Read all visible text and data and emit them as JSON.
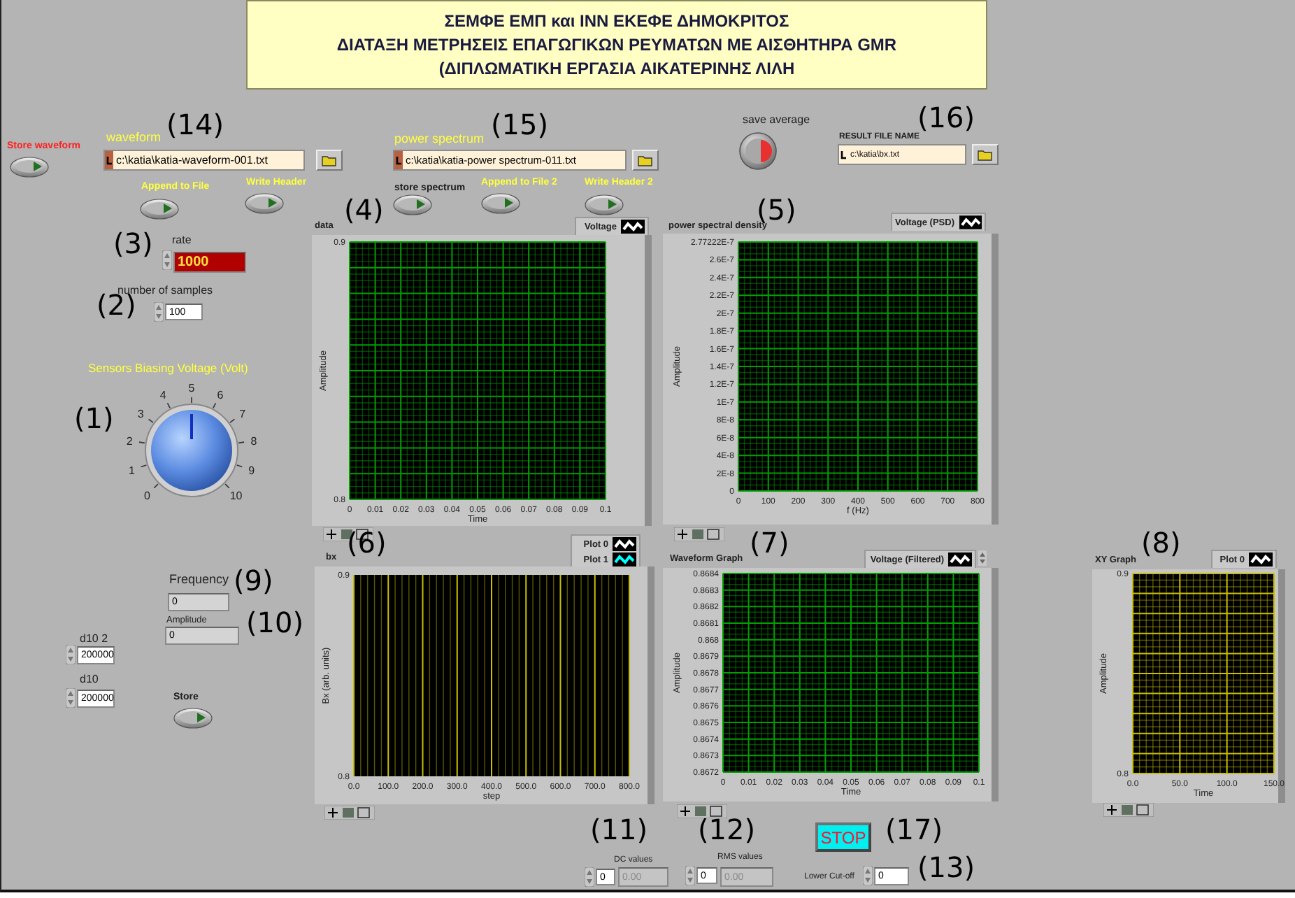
{
  "header": {
    "lines": [
      "ΣΕΜΦΕ ΕΜΠ και ΙΝΝ ΕΚΕΦΕ ΔΗΜΟΚΡΙΤΟΣ",
      "ΔΙΑΤΑΞΗ ΜΕΤΡΗΣΕΙΣ ΕΠΑΓΩΓΙΚΩΝ ΡΕΥΜΑΤΩΝ ΜΕ ΑΙΣΘΗΤΗΡΑ GMR",
      "(ΔΙΠΛΩΜΑΤΙΚΗ ΕΡΓΑΣΙΑ ΑΙΚΑΤΕΡΙΝΗΣ ΛΙΛΗ"
    ]
  },
  "path_controls": [
    {
      "label": "waveform",
      "color": "#ffff40",
      "value": "c:\\katia\\katia-waveform-001.txt",
      "callout": "(14)"
    },
    {
      "label": "power spectrum",
      "color": "#ffff40",
      "value": "c:\\katia\\katia-power spectrum-011.txt",
      "callout": "(15)"
    },
    {
      "label": "RESULT FILE NAME",
      "color": "#202020",
      "value": "c:\\katia\\bx.txt",
      "callout": "(16)"
    }
  ],
  "toggles": [
    {
      "label": "Store waveform",
      "color": "#ff2020",
      "on": false
    },
    {
      "label": "Append to File",
      "color": "#ffff40",
      "on": false
    },
    {
      "label": "Write Header",
      "color": "#ffff40",
      "on": false
    },
    {
      "label": "store spectrum",
      "color": "#202020",
      "on": false
    },
    {
      "label": "Append to File 2",
      "color": "#ffff40",
      "on": false
    },
    {
      "label": "Write Header 2",
      "color": "#ffff40",
      "on": false
    },
    {
      "label": "Store",
      "color": "#202020",
      "on": false
    }
  ],
  "save_average": {
    "label": "save average"
  },
  "numerics": [
    {
      "kind": "control",
      "label": "rate",
      "value": "1000",
      "color": "#b00000",
      "disabled": false,
      "callout": "(3)"
    },
    {
      "kind": "control",
      "label": "number of samples",
      "value": "100",
      "color": "#ffffff",
      "disabled": false,
      "callout": "(2)"
    },
    {
      "kind": "control",
      "label": "d10 2",
      "value": "200000",
      "color": "#ffffff",
      "disabled": false
    },
    {
      "kind": "control",
      "label": "d10",
      "value": "200000",
      "color": "#ffffff",
      "disabled": false
    },
    {
      "kind": "indicator",
      "label": "Frequency",
      "value": "0",
      "color": "#d4d4d4",
      "disabled": false,
      "callout": "(9)"
    },
    {
      "kind": "indicator",
      "label": "Amplitude",
      "value": "0",
      "color": "#d4d4d4",
      "disabled": false,
      "callout": "(10)"
    },
    {
      "kind": "control",
      "value": "0",
      "color": "#ffffff",
      "disabled": false,
      "callout": "(11)"
    },
    {
      "kind": "indicator",
      "label": "DC values",
      "value": "0.00",
      "color": "#c4c4c4",
      "disabled": true
    },
    {
      "kind": "control",
      "value": "0",
      "color": "#ffffff",
      "disabled": false,
      "callout": "(12)"
    },
    {
      "kind": "indicator",
      "label": "RMS values",
      "value": "0.00",
      "color": "#c4c4c4",
      "disabled": true
    },
    {
      "kind": "control",
      "label": "Lower Cut-off",
      "value": "0",
      "color": "#ffffff",
      "disabled": false,
      "callout": "(13)"
    }
  ],
  "knob": {
    "label": "Sensors Biasing Voltage (Volt)",
    "ticks": [
      "0",
      "1",
      "2",
      "3",
      "4",
      "5",
      "6",
      "7",
      "8",
      "9",
      "10"
    ],
    "level": 0.5,
    "callout": "(1)"
  },
  "graphs": [
    {
      "title": "data",
      "callout": "(4)",
      "kind": "grid",
      "color": "#00a000",
      "legend": [
        {
          "name": "Voltage",
          "color": "#ffffff"
        }
      ],
      "x_ticks": [
        "0",
        "0.01",
        "0.02",
        "0.03",
        "0.04",
        "0.05",
        "0.06",
        "0.07",
        "0.08",
        "0.09",
        "0.1"
      ],
      "y_ticks": [
        "0.9",
        "0.8"
      ],
      "x_label": "Time",
      "y_label": "Amplitude"
    },
    {
      "title": "power spectral density",
      "callout": "(5)",
      "kind": "grid",
      "color": "#00a000",
      "legend": [
        {
          "name": "Voltage (PSD)",
          "color": "#ffffff"
        }
      ],
      "x_ticks": [
        "0",
        "100",
        "200",
        "300",
        "400",
        "500",
        "600",
        "700",
        "800"
      ],
      "y_ticks": [
        "2.77222E-7",
        "2.6E-7",
        "2.4E-7",
        "2.2E-7",
        "2E-7",
        "1.8E-7",
        "1.6E-7",
        "1.4E-7",
        "1.2E-7",
        "1E-7",
        "8E-8",
        "6E-8",
        "4E-8",
        "2E-8",
        "0"
      ],
      "x_label": "f (Hz)",
      "y_label": "Amplitude"
    },
    {
      "title": "bx",
      "callout": "(6)",
      "kind": "stripes",
      "color": "#c8c000",
      "legend": [
        {
          "name": "Plot 0",
          "color": "#ffffff"
        },
        {
          "name": "Plot 1",
          "color": "#00ffff"
        }
      ],
      "x_ticks": [
        "0.0",
        "100.0",
        "200.0",
        "300.0",
        "400.0",
        "500.0",
        "600.0",
        "700.0",
        "800.0"
      ],
      "y_ticks": [
        "0.9",
        "0.8"
      ],
      "x_label": "step",
      "y_label": "Bx (arb. units)"
    },
    {
      "title": "Waveform Graph",
      "callout": "(7)",
      "kind": "grid",
      "color": "#00a000",
      "legend": [
        {
          "name": "Voltage (Filtered)",
          "color": "#ffffff"
        }
      ],
      "x_ticks": [
        "0",
        "0.01",
        "0.02",
        "0.03",
        "0.04",
        "0.05",
        "0.06",
        "0.07",
        "0.08",
        "0.09",
        "0.1"
      ],
      "y_ticks": [
        "0.8684",
        "0.8683",
        "0.8682",
        "0.8681",
        "0.868",
        "0.8679",
        "0.8678",
        "0.8677",
        "0.8676",
        "0.8675",
        "0.8674",
        "0.8673",
        "0.8672"
      ],
      "x_label": "Time",
      "y_label": "Amplitude"
    },
    {
      "title": "XY Graph",
      "callout": "(8)",
      "kind": "grid",
      "color": "#c8c000",
      "legend": [
        {
          "name": "Plot 0",
          "color": "#ffffff"
        }
      ],
      "x_ticks": [
        "0.0",
        "50.0",
        "100.0",
        "150.0"
      ],
      "y_ticks": [
        "0.9",
        "0.8"
      ],
      "x_label": "Time",
      "y_label": "Amplitude"
    }
  ],
  "stop_button": {
    "label": "STOP",
    "callout": "(17)"
  }
}
